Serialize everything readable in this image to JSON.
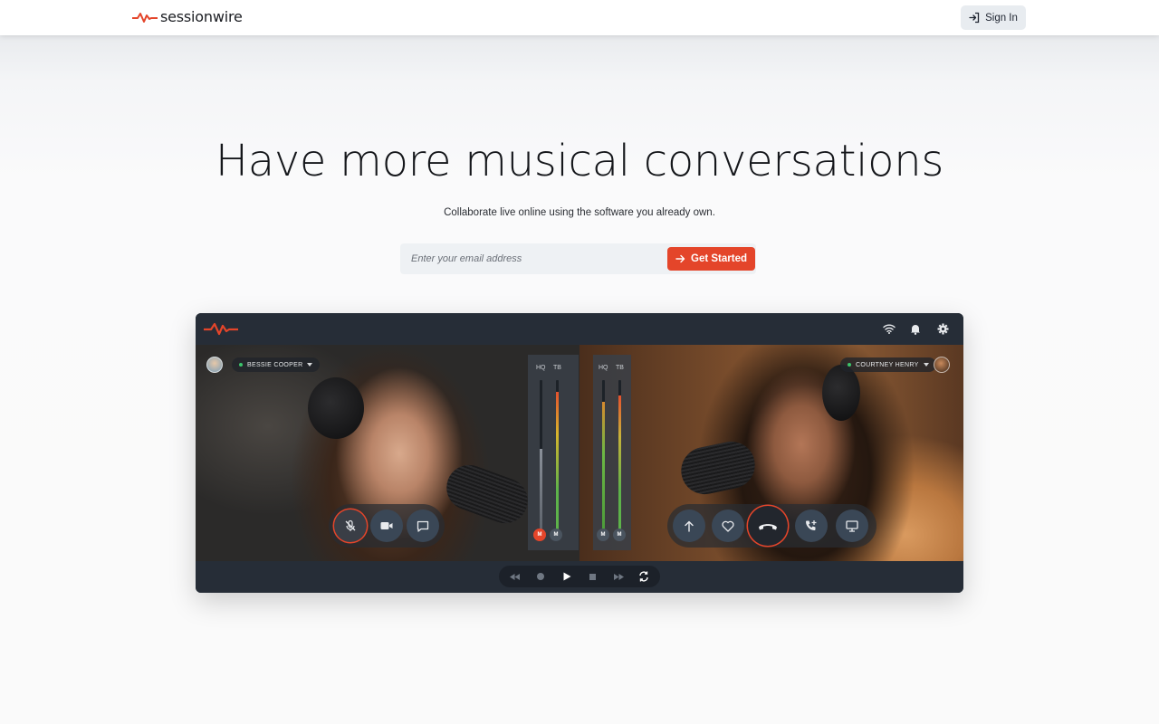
{
  "header": {
    "brand": "sessionwire",
    "signin_label": "Sign In"
  },
  "hero": {
    "title": "Have more musical conversations",
    "subtitle": "Collaborate live online using the software you already own.",
    "email_placeholder": "Enter your email address",
    "cta_label": "Get Started"
  },
  "app_preview": {
    "left_user": "BESSIE COOPER",
    "right_user": "COURTNEY HENRY",
    "meter_labels": [
      "HQ",
      "TB"
    ],
    "mute_label": "M",
    "left_controls": [
      "mic-off-icon",
      "video-camera-icon",
      "chat-icon"
    ],
    "right_controls": [
      "upload-icon",
      "heart-icon",
      "hang-up-icon",
      "add-call-icon",
      "screen-share-icon"
    ],
    "transport": [
      "rewind-icon",
      "record-icon",
      "play-icon",
      "stop-icon",
      "fast-forward-icon",
      "loop-icon"
    ],
    "top_icons": [
      "wifi-icon",
      "bell-icon",
      "gear-icon"
    ]
  },
  "colors": {
    "accent": "#e4452a",
    "online": "#3bc46b",
    "app_bg": "#232a33"
  }
}
